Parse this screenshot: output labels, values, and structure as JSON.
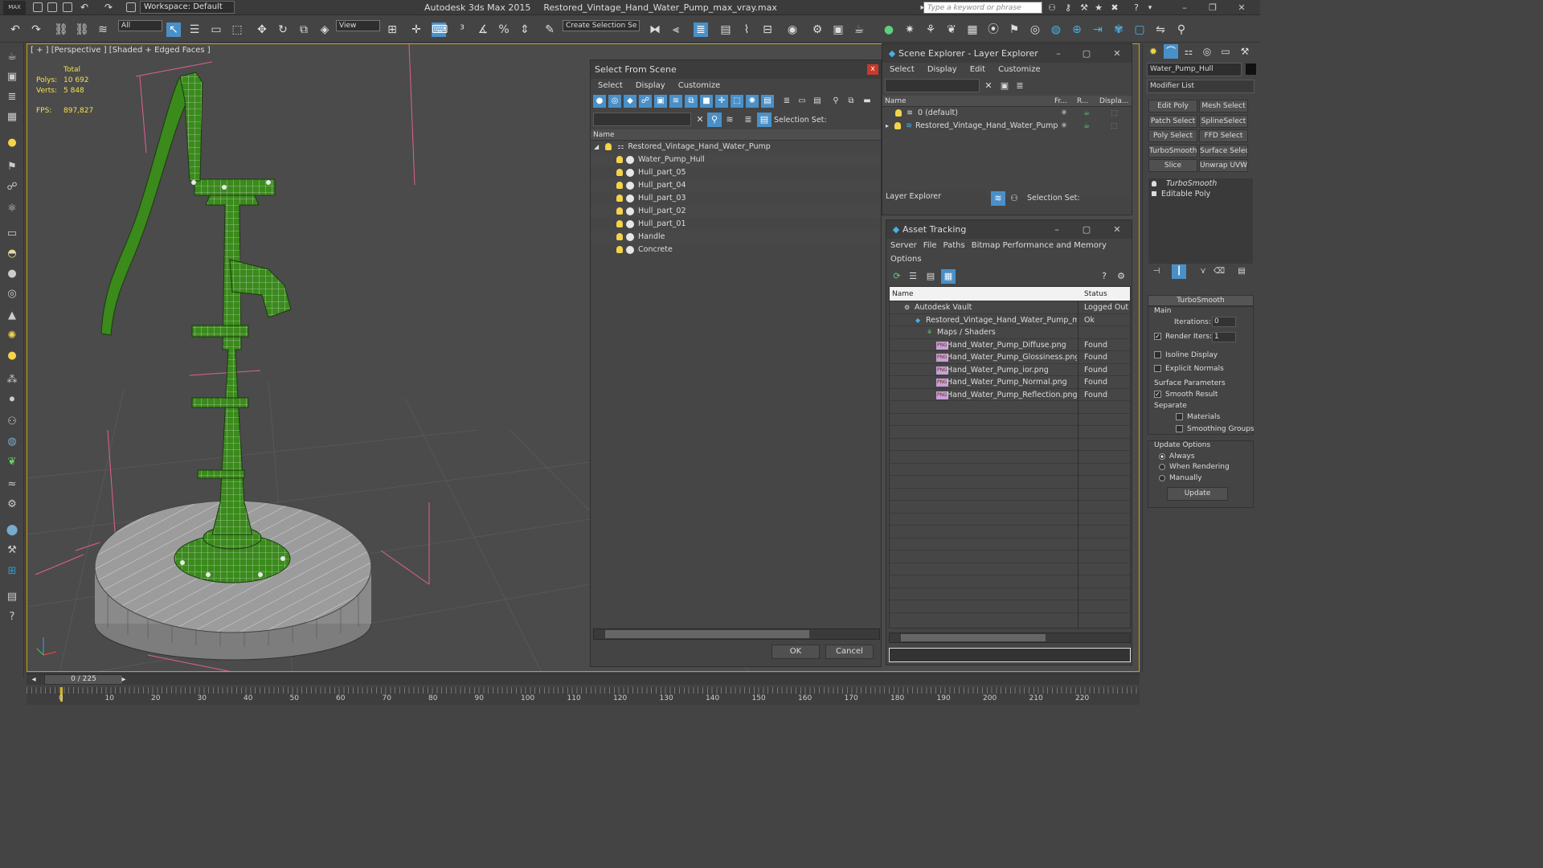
{
  "app": {
    "logo": "MAX",
    "workspace": "Workspace: Default",
    "name": "Autodesk 3ds Max  2015",
    "file": "Restored_Vintage_Hand_Water_Pump_max_vray.max",
    "search_placeholder": "Type a keyword or phrase"
  },
  "toolbar": {
    "filter": "All",
    "ref_coord": "View",
    "selection_set": "Create Selection Se"
  },
  "viewport": {
    "label": "[ + ] [Perspective ] [Shaded + Edged Faces ]",
    "stats": {
      "total_label": "Total",
      "polys_label": "Polys:",
      "polys": "10 692",
      "verts_label": "Verts:",
      "verts": "5 848",
      "fps_label": "FPS:",
      "fps": "897,827"
    }
  },
  "select_from_scene": {
    "title": "Select From Scene",
    "menu": [
      "Select",
      "Display",
      "Customize"
    ],
    "selection_set_label": "Selection Set:",
    "column_name": "Name",
    "root": "Restored_Vintage_Hand_Water_Pump",
    "items": [
      "Water_Pump_Hull",
      "Hull_part_05",
      "Hull_part_04",
      "Hull_part_03",
      "Hull_part_02",
      "Hull_part_01",
      "Handle",
      "Concrete"
    ],
    "ok": "OK",
    "cancel": "Cancel"
  },
  "scene_explorer": {
    "title": "Scene Explorer - Layer Explorer",
    "menu": [
      "Select",
      "Display",
      "Edit",
      "Customize"
    ],
    "columns": [
      "Name",
      "Fr...",
      "R...",
      "Displa..."
    ],
    "layers": [
      "0 (default)",
      "Restored_Vintage_Hand_Water_Pump"
    ],
    "footer_dropdown": "Layer Explorer",
    "selection_set_label": "Selection Set:"
  },
  "asset_tracking": {
    "title": "Asset Tracking",
    "menu": [
      "Server",
      "File",
      "Paths",
      "Bitmap Performance and Memory"
    ],
    "menu2": "Options",
    "columns": [
      "Name",
      "Status"
    ],
    "rows": [
      {
        "name": "Autodesk Vault",
        "status": "Logged Out"
      },
      {
        "name": "Restored_Vintage_Hand_Water_Pump_m...",
        "status": "Ok"
      },
      {
        "name": "Maps / Shaders",
        "status": ""
      },
      {
        "name": "Hand_Water_Pump_Diffuse.png",
        "status": "Found"
      },
      {
        "name": "Hand_Water_Pump_Glossiness.png",
        "status": "Found"
      },
      {
        "name": "Hand_Water_Pump_ior.png",
        "status": "Found"
      },
      {
        "name": "Hand_Water_Pump_Normal.png",
        "status": "Found"
      },
      {
        "name": "Hand_Water_Pump_Reflection.png",
        "status": "Found"
      }
    ],
    "png_tag": "PNG"
  },
  "command_panel": {
    "object_name": "Water_Pump_Hull",
    "modifier_list": "Modifier List",
    "buttons": [
      "Edit Poly",
      "Mesh Select",
      "Patch Select",
      "SplineSelect",
      "Poly Select",
      "FFD Select",
      "TurboSmooth",
      "Surface Select",
      "Slice",
      "Unwrap UVW"
    ],
    "stack": [
      "TurboSmooth",
      "Editable Poly"
    ],
    "rollout": "TurboSmooth",
    "main": "Main",
    "iterations_label": "Iterations:",
    "iterations": "0",
    "render_iters_label": "Render Iters:",
    "render_iters": "1",
    "isoline": "Isoline Display",
    "explicit": "Explicit Normals",
    "surface_params": "Surface Parameters",
    "smooth_result": "Smooth Result",
    "separate": "Separate",
    "materials": "Materials",
    "smoothing_groups": "Smoothing Groups",
    "update_options": "Update Options",
    "always": "Always",
    "when_rendering": "When Rendering",
    "manually": "Manually",
    "update": "Update"
  },
  "timeline": {
    "frame": "0 / 225",
    "ticks": [
      "0",
      "10",
      "20",
      "30",
      "40",
      "50",
      "60",
      "70",
      "80",
      "90",
      "100",
      "110",
      "120",
      "130",
      "140",
      "150",
      "160",
      "170",
      "180",
      "190",
      "200",
      "210",
      "220"
    ]
  },
  "colors": {
    "mesh_green": "#3a8a1c",
    "selection_blue": "#3d86d6",
    "stats_yellow": "#f4e14a",
    "viewport_border": "#c9a400"
  }
}
